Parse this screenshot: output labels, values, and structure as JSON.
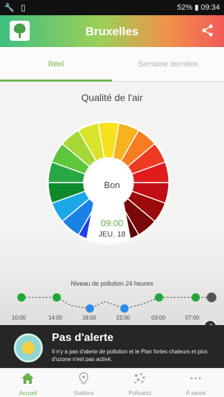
{
  "status_bar": {
    "left_icons": "🔧 ▯",
    "right_text": "52% ▮ 09:34"
  },
  "app_bar": {
    "title": "Bruxelles",
    "logo_icon": "tree-icon",
    "share_icon": "share-icon"
  },
  "tabs": [
    {
      "label": "Réel",
      "active": true
    },
    {
      "label": "Semaine dernière",
      "active": false
    }
  ],
  "gauge": {
    "title": "Qualité de l'air",
    "center_label": "Bon",
    "time": "09:00",
    "date": "JEU. 18",
    "colors": [
      "#f7e11c",
      "#f6b21f",
      "#f57d20",
      "#ee3a23",
      "#e01b1b",
      "#c20f15",
      "#9c0b0b",
      "#7a0808",
      "#5a0606",
      "#3010b8",
      "#2040e8",
      "#1a82e6",
      "#1aa8e8",
      "#0e8a2d",
      "#27a844",
      "#5ec63b",
      "#a7d737",
      "#d8e32a"
    ]
  },
  "pollution": {
    "title": "Niveau de pollution 24 heures",
    "ticks": [
      "10:00",
      "14:00",
      "18:00",
      "22:00",
      "03:00",
      "07:00"
    ],
    "point_colors": {
      "good": "#1fa83a",
      "better": "#2b8de6",
      "current": "#555555"
    }
  },
  "alert": {
    "icon": "smiley-icon",
    "title": "Pas d'alerte",
    "text": "Il n'y a pas d'alerte de pollution et le Plan fortes chaleurs et pics d'ozone n'est pas activé."
  },
  "bottom_nav": [
    {
      "label": "Accueil",
      "icon": "home-icon",
      "active": true
    },
    {
      "label": "Stations",
      "icon": "location-pin-icon",
      "active": false
    },
    {
      "label": "Polluants",
      "icon": "molecules-icon",
      "active": false
    },
    {
      "label": "À savoir",
      "icon": "more-icon",
      "active": false
    }
  ],
  "accent_color": "#6ab24b"
}
